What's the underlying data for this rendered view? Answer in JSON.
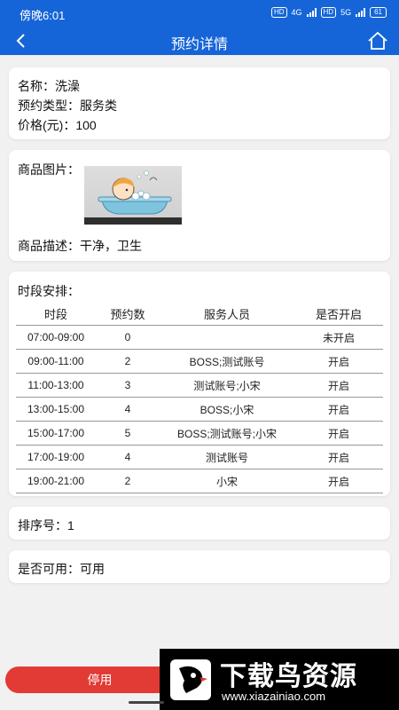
{
  "status": {
    "time": "傍晚6:01",
    "hd1": "HD",
    "net1": "4G",
    "hd2": "HD",
    "net2": "5G",
    "battery": "61"
  },
  "nav": {
    "title": "预约详情",
    "back_icon": "chevron-left-icon",
    "home_icon": "home-icon"
  },
  "info": {
    "name": "名称：洗澡",
    "type": "预约类型：服务类",
    "price": "价格(元)：100"
  },
  "goods": {
    "image_label": "商品图片：",
    "desc": "商品描述：干净，卫生"
  },
  "slots": {
    "title": "时段安排：",
    "headers": [
      "时段",
      "预约数",
      "服务人员",
      "是否开启"
    ],
    "rows": [
      [
        "07:00-09:00",
        "0",
        "",
        "未开启"
      ],
      [
        "09:00-11:00",
        "2",
        "BOSS;测试账号",
        "开启"
      ],
      [
        "11:00-13:00",
        "3",
        "测试账号;小宋",
        "开启"
      ],
      [
        "13:00-15:00",
        "4",
        "BOSS;小宋",
        "开启"
      ],
      [
        "15:00-17:00",
        "5",
        "BOSS;测试账号;小宋",
        "开启"
      ],
      [
        "17:00-19:00",
        "4",
        "测试账号",
        "开启"
      ],
      [
        "19:00-21:00",
        "2",
        "小宋",
        "开启"
      ]
    ]
  },
  "sort": {
    "label": "排序号：1"
  },
  "available": {
    "label": "是否可用：可用"
  },
  "stop_button": "停用",
  "watermark": {
    "title": "下载鸟资源",
    "url": "www.xiazainiao.com"
  },
  "colors": {
    "primary": "#1565d8",
    "danger": "#e23a35",
    "background": "#f1f1f1"
  }
}
